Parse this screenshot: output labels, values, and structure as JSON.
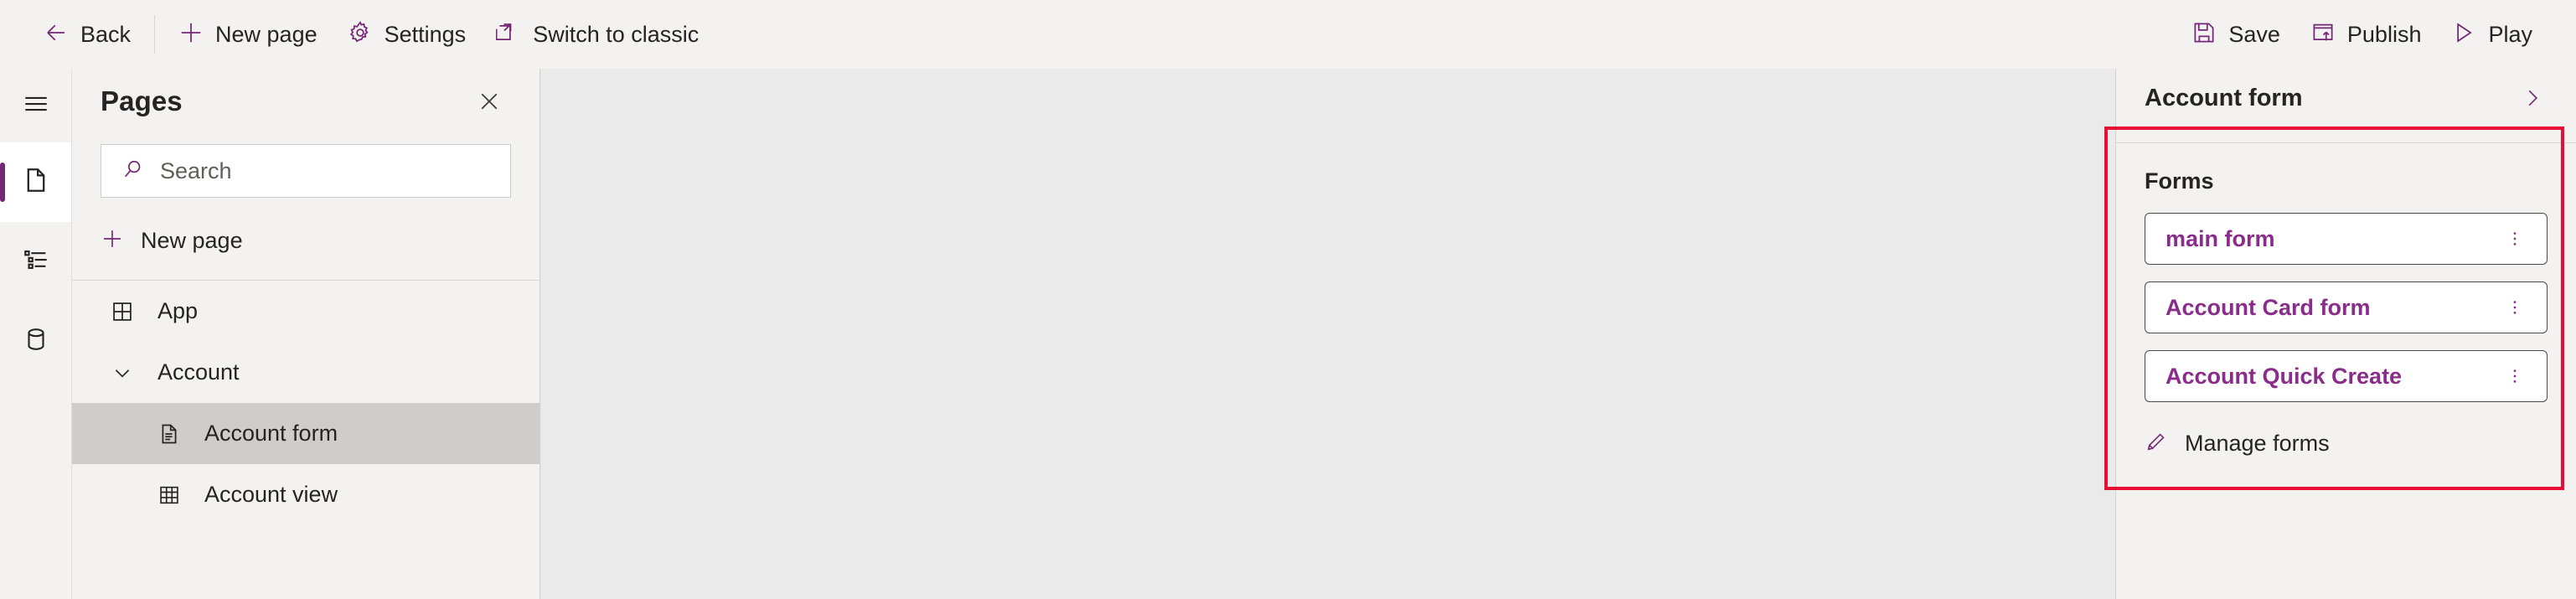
{
  "toolbar": {
    "left_items": [
      {
        "label": "Back",
        "icon": "arrow-left-icon"
      },
      {
        "label": "New page",
        "icon": "plus-icon"
      },
      {
        "label": "Settings",
        "icon": "gear-icon"
      },
      {
        "label": "Switch to classic",
        "icon": "open-in-new-icon"
      }
    ],
    "right_items": [
      {
        "label": "Save",
        "icon": "save-icon"
      },
      {
        "label": "Publish",
        "icon": "publish-icon"
      },
      {
        "label": "Play",
        "icon": "play-icon"
      }
    ]
  },
  "rail": {
    "items": [
      {
        "name": "menu",
        "icon": "hamburger-icon",
        "selected": false
      },
      {
        "name": "pages",
        "icon": "page-icon",
        "selected": true
      },
      {
        "name": "navigation",
        "icon": "list-icon",
        "selected": false
      },
      {
        "name": "data",
        "icon": "database-icon",
        "selected": false
      }
    ]
  },
  "pages_panel": {
    "title": "Pages",
    "close_icon": "close-icon",
    "search": {
      "placeholder": "Search",
      "value": "",
      "icon": "search-icon"
    },
    "new_page": {
      "label": "New page",
      "icon": "plus-icon"
    },
    "tree": [
      {
        "label": "App",
        "icon": "app-grid-icon",
        "level": 0,
        "selected": false,
        "expandable": false
      },
      {
        "label": "Account",
        "icon": "chevron-down-icon",
        "level": 0,
        "selected": false,
        "expandable": true
      },
      {
        "label": "Account form",
        "icon": "form-document-icon",
        "level": 1,
        "selected": true,
        "expandable": false
      },
      {
        "label": "Account view",
        "icon": "table-grid-icon",
        "level": 1,
        "selected": false,
        "expandable": false
      }
    ]
  },
  "right_panel": {
    "title": "Account form",
    "collapse_icon": "chevron-right-icon",
    "section_title": "Forms",
    "forms": [
      {
        "label": "main form",
        "menu_icon": "more-vertical-icon"
      },
      {
        "label": "Account Card form",
        "menu_icon": "more-vertical-icon"
      },
      {
        "label": "Account Quick Create",
        "menu_icon": "more-vertical-icon"
      }
    ],
    "manage_forms": {
      "label": "Manage forms",
      "icon": "pencil-icon"
    }
  },
  "colors": {
    "accent": "#742774",
    "link": "#8a2d8a",
    "annotation": "#e60f33",
    "panel_bg": "#f3f2f1",
    "canvas_bg": "#eaeaea",
    "selected_row": "#cfcdcb"
  }
}
